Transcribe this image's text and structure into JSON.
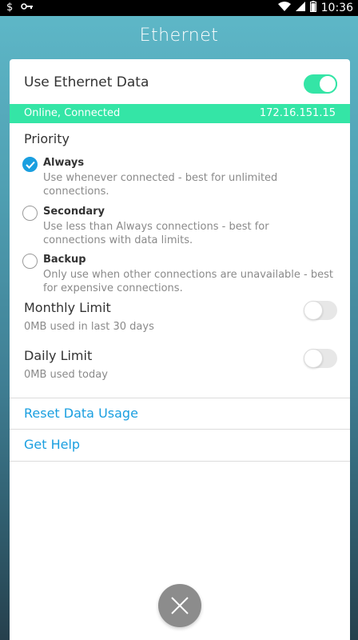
{
  "status_bar": {
    "time": "10:36",
    "icons": [
      "dollar-icon",
      "key-icon",
      "wifi-icon",
      "signal-icon",
      "battery-icon"
    ]
  },
  "app": {
    "title": "Ethernet"
  },
  "ethernet": {
    "label": "Use Ethernet Data",
    "enabled": true,
    "status_text": "Online, Connected",
    "ip_address": "172.16.151.15"
  },
  "priority": {
    "label": "Priority",
    "options": [
      {
        "title": "Always",
        "description": "Use whenever connected - best for unlimited connections.",
        "selected": true
      },
      {
        "title": "Secondary",
        "description": "Use less than Always connections - best for connections with data limits.",
        "selected": false
      },
      {
        "title": "Backup",
        "description": "Only use when other connections are unavailable - best for expensive connections.",
        "selected": false
      }
    ]
  },
  "limits": {
    "monthly": {
      "label": "Monthly Limit",
      "usage": "0MB used in last 30 days",
      "enabled": false
    },
    "daily": {
      "label": "Daily Limit",
      "usage": "0MB used today",
      "enabled": false
    }
  },
  "actions": {
    "reset_label": "Reset Data Usage",
    "help_label": "Get Help"
  },
  "colors": {
    "accent_green": "#34e5a6",
    "link_blue": "#1a9fe0",
    "fab_gray": "#8c8c8c"
  }
}
